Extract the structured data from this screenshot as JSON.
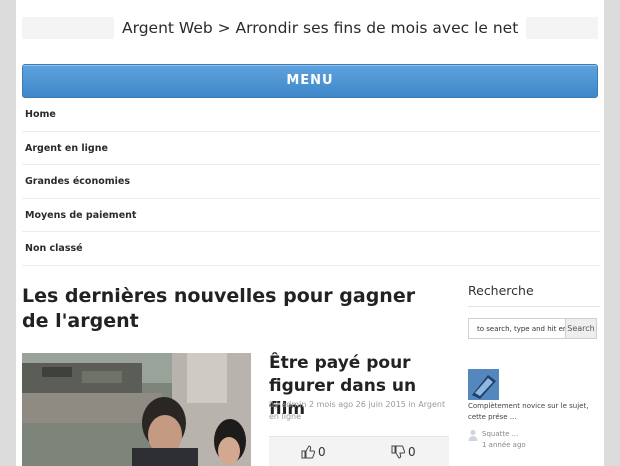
{
  "header": {
    "title": "Argent Web > Arrondir ses fins de mois avec le net"
  },
  "menu": {
    "label": "MENU"
  },
  "nav": {
    "items": [
      {
        "label": "Home"
      },
      {
        "label": "Argent en ligne"
      },
      {
        "label": "Grandes économies"
      },
      {
        "label": "Moyens de paiement"
      },
      {
        "label": "Non classé"
      }
    ]
  },
  "section": {
    "title_bold": "Les",
    "title_rest": " dernières nouvelles pour gagner de l'argent"
  },
  "post": {
    "title": "Être payé pour figurer dans un film",
    "meta_by": "by",
    "meta_author": "admin",
    "meta_age": "2 mois ago",
    "meta_date": "26 juin 2015",
    "meta_in": "in",
    "meta_category": "Argent en ligne",
    "likes": "0",
    "dislikes": "0"
  },
  "sidebar": {
    "heading": "Recherche",
    "search_placeholder": "to search, type and hit enter",
    "search_button": "Search",
    "comment_excerpt": "Complètement novice sur le sujet, cette prése ...",
    "comment_user": "Squatte ...",
    "comment_age": "1 année ago"
  },
  "colors": {
    "menu_blue": "#4a90d0",
    "background": "#dcdcdc"
  }
}
